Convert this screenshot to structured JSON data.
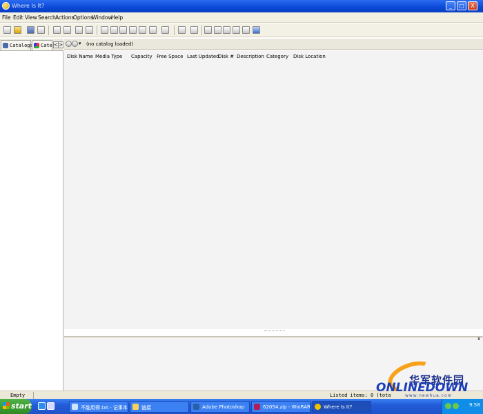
{
  "window": {
    "title": "Where Is It?",
    "min_glyph": "_",
    "max_glyph": "□",
    "close_glyph": "X"
  },
  "menu": {
    "items": [
      "File",
      "Edit",
      "View",
      "Search",
      "Actions",
      "Options",
      "Window",
      "Help"
    ]
  },
  "left_panel": {
    "tabs": [
      "Catalogs",
      "Cate"
    ],
    "tab_icons": [
      "catalogs-icon",
      "categories-icon"
    ],
    "scroll_left": "<",
    "scroll_right": ">"
  },
  "main": {
    "nav_label": "(no catalog loaded)",
    "nav_dropdown": "▾",
    "columns": [
      "Disk Name",
      "Media Type",
      "Capacity",
      "Free Space",
      "Last Updated",
      "Disk #",
      "Description",
      "Category",
      "Disk Location"
    ],
    "detail_close": "x"
  },
  "status": {
    "left": "Empty",
    "right": "Listed items: 0 (tota"
  },
  "taskbar": {
    "start_label": "start",
    "tasks": [
      "不能用得.txt - 记事本",
      "链接",
      "Adobe Photoshop",
      "62054.zip - WinRAR",
      "Where Is It?"
    ],
    "clock": "9:58"
  },
  "watermark": {
    "cn": "华军软件园",
    "en": "ONLINEDOWN",
    "url": "www.newhua.com"
  },
  "colors": {
    "title_bar": "#0a48d6",
    "start_button": "#2f8a26",
    "taskbar": "#225cd8",
    "watermark_orange": "#f7a21b",
    "watermark_blue": "#1b3eb8"
  }
}
